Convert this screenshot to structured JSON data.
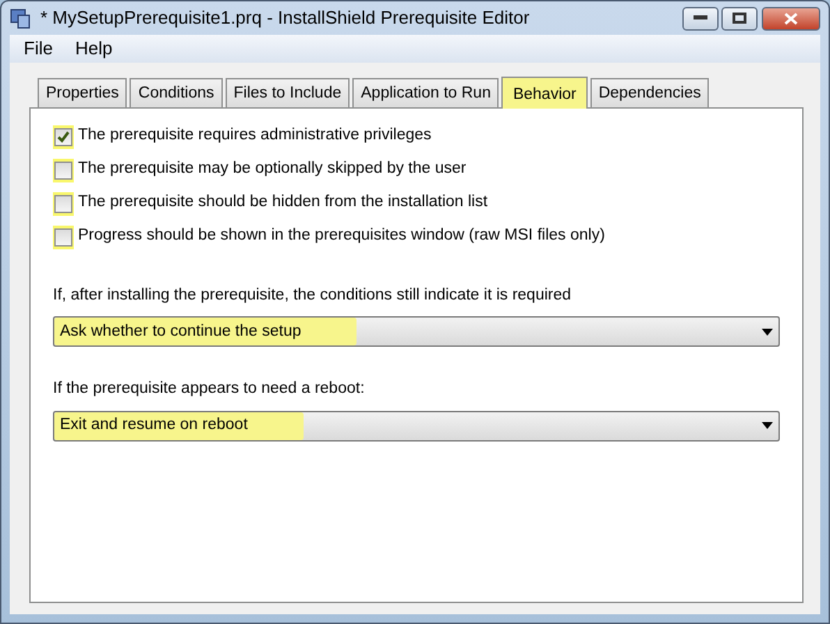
{
  "window": {
    "title": "* MySetupPrerequisite1.prq - InstallShield Prerequisite Editor"
  },
  "menu": [
    "File",
    "Help"
  ],
  "tabs": [
    {
      "label": "Properties",
      "selected": false,
      "highlighted": false
    },
    {
      "label": "Conditions",
      "selected": false,
      "highlighted": false
    },
    {
      "label": "Files to Include",
      "selected": false,
      "highlighted": false
    },
    {
      "label": "Application to Run",
      "selected": false,
      "highlighted": false
    },
    {
      "label": "Behavior",
      "selected": true,
      "highlighted": true
    },
    {
      "label": "Dependencies",
      "selected": false,
      "highlighted": false
    }
  ],
  "options": [
    {
      "label": "The prerequisite requires administrative privileges",
      "checked": true,
      "highlighted": true
    },
    {
      "label": "The prerequisite may be optionally skipped by the user",
      "checked": false,
      "highlighted": true
    },
    {
      "label": "The prerequisite should be hidden from the installation list",
      "checked": false,
      "highlighted": true
    },
    {
      "label": "Progress should be shown in the prerequisites window (raw MSI files only)",
      "checked": false,
      "highlighted": true
    }
  ],
  "dropdowns": [
    {
      "label": "If, after installing the prerequisite, the conditions still indicate it is required",
      "value": "Ask whether to continue the setup",
      "highlighted": true
    },
    {
      "label": "If the prerequisite appears to need a reboot:",
      "value": "Exit and resume on reboot",
      "highlighted": true
    }
  ]
}
